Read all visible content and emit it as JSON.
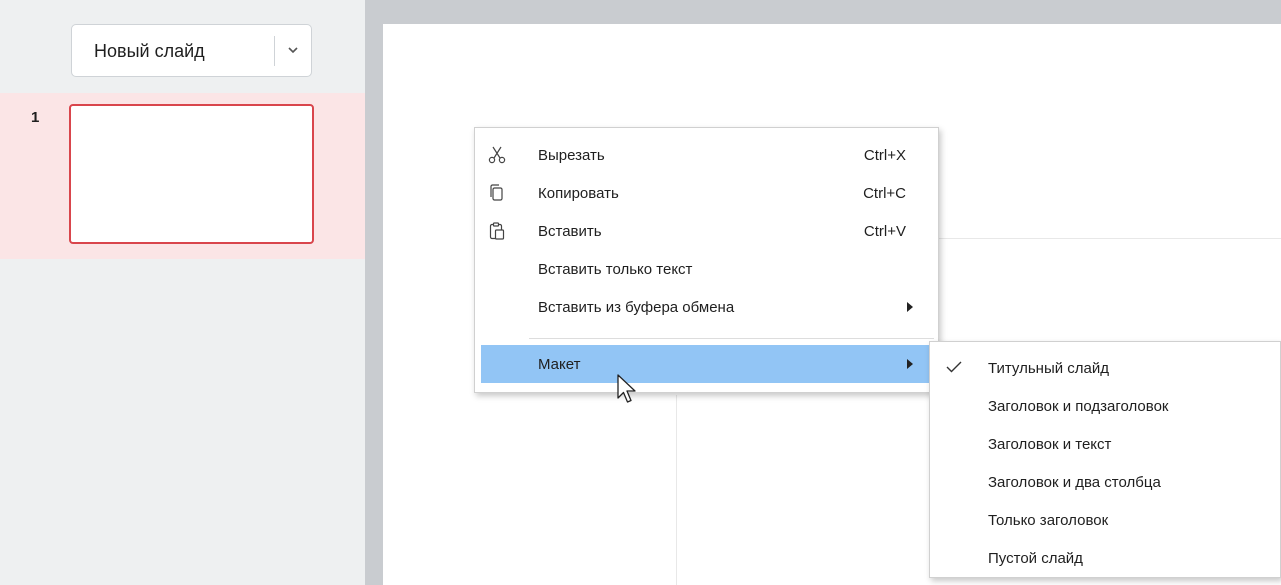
{
  "sidebar": {
    "new_slide_label": "Новый слайд",
    "slides": [
      {
        "number": "1"
      }
    ]
  },
  "context_menu": {
    "items": [
      {
        "label": "Вырезать",
        "shortcut": "Ctrl+X",
        "icon": "scissors-icon"
      },
      {
        "label": "Копировать",
        "shortcut": "Ctrl+C",
        "icon": "copy-icon"
      },
      {
        "label": "Вставить",
        "shortcut": "Ctrl+V",
        "icon": "paste-icon"
      },
      {
        "label": "Вставить только текст"
      },
      {
        "label": "Вставить из буфера обмена",
        "submenu": true
      },
      {
        "label": "Макет",
        "submenu": true,
        "highlighted": true
      }
    ]
  },
  "layout_submenu": {
    "items": [
      {
        "label": "Титульный слайд",
        "checked": true
      },
      {
        "label": "Заголовок и подзаголовок"
      },
      {
        "label": "Заголовок и текст"
      },
      {
        "label": "Заголовок и два столбца"
      },
      {
        "label": "Только заголовок"
      },
      {
        "label": "Пустой слайд"
      }
    ]
  },
  "colors": {
    "highlight": "#92c5f5",
    "selected_slide_bg": "#fbe5e6",
    "selected_slide_border": "#d9454c"
  }
}
